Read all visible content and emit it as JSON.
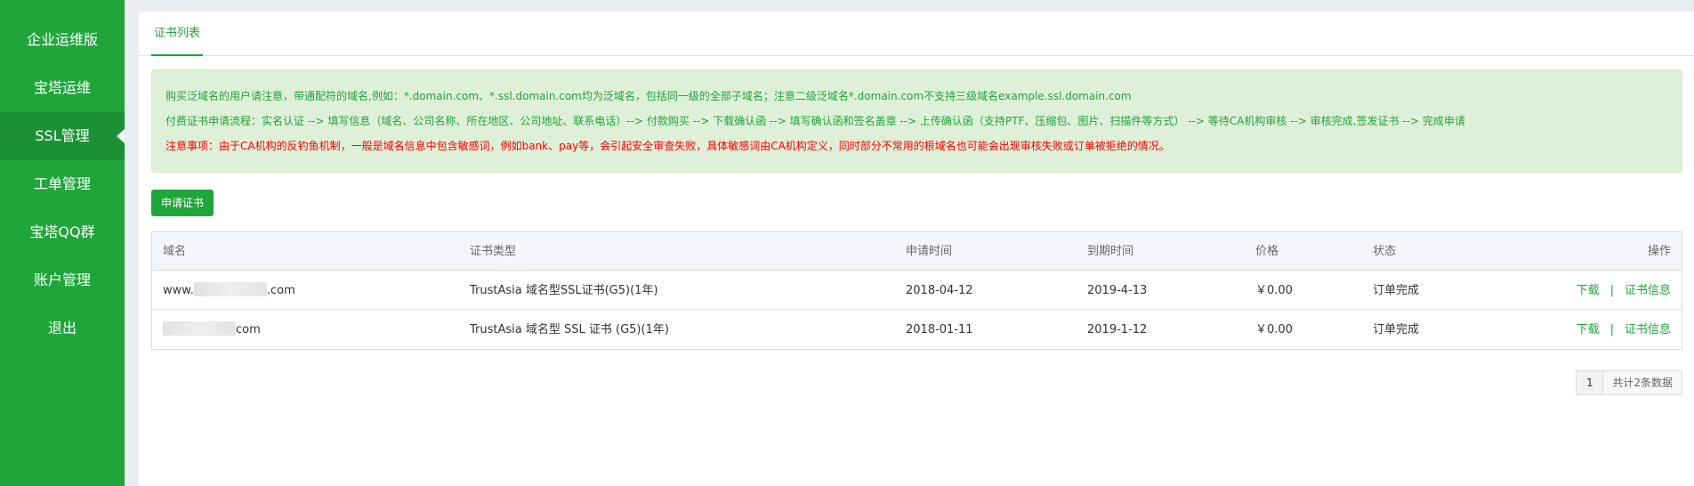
{
  "sidebar": {
    "items": [
      {
        "label": "企业运维版"
      },
      {
        "label": "宝塔运维"
      },
      {
        "label": "SSL管理"
      },
      {
        "label": "工单管理"
      },
      {
        "label": "宝塔QQ群"
      },
      {
        "label": "账户管理"
      },
      {
        "label": "退出"
      }
    ],
    "active_index": 2
  },
  "tabs": [
    {
      "label": "证书列表"
    }
  ],
  "notice": {
    "line1": "购买泛域名的用户请注意，带通配符的域名,例如：*.domain.com、*.ssl.domain.com均为泛域名，包括同一级的全部子域名；注意二级泛域名*.domain.com不支持三级域名example.ssl.domain.com",
    "line2": "付费证书申请流程：实名认证 --> 填写信息（域名、公司名称、所在地区、公司地址、联系电话）--> 付款购买 --> 下载确认函 --> 填写确认函和签名盖章 --> 上传确认函（支持PTF、压缩包、图片、扫描件等方式） --> 等待CA机构审核 --> 审核完成,签发证书 --> 完成申请",
    "line3": "注意事项：由于CA机构的反钓鱼机制，一般是域名信息中包含敏感词，例如bank、pay等，会引起安全审查失败，具体敏感词由CA机构定义，同时部分不常用的根域名也可能会出现审核失败或订单被拒绝的情况。"
  },
  "actions": {
    "apply_label": "申请证书"
  },
  "table": {
    "headers": {
      "domain": "域名",
      "type": "证书类型",
      "apply_time": "申请时间",
      "expire_time": "到期时间",
      "price": "价格",
      "status": "状态",
      "op": "操作"
    },
    "rows": [
      {
        "domain_prefix": "www.",
        "domain_suffix": ".com",
        "type": "TrustAsia 域名型SSL证书(G5)(1年)",
        "apply_time": "2018-04-12",
        "expire_time": "2019-4-13",
        "price": "￥0.00",
        "status": "订单完成",
        "download": "下载",
        "separator": "|",
        "info": "证书信息"
      },
      {
        "domain_prefix": "",
        "domain_suffix": "com",
        "type": "TrustAsia 域名型 SSL 证书 (G5)(1年)",
        "apply_time": "2018-01-11",
        "expire_time": "2019-1-12",
        "price": "￥0.00",
        "status": "订单完成",
        "download": "下载",
        "separator": "|",
        "info": "证书信息"
      }
    ]
  },
  "pager": {
    "page": "1",
    "total": "共计2条数据"
  },
  "colors": {
    "brand": "#20a53a",
    "warning": "#ff0000",
    "notice_bg": "#dff0d8"
  }
}
